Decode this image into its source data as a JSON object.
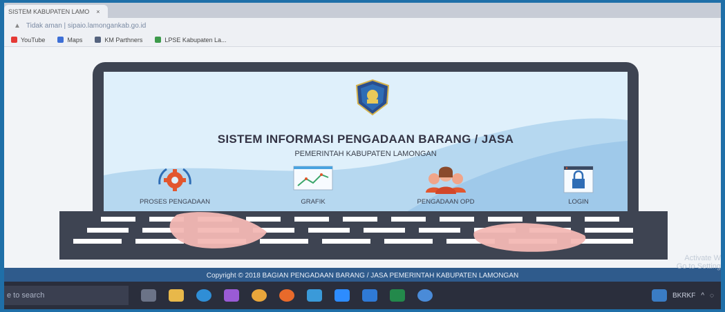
{
  "browser": {
    "tab_title": "SISTEM KABUPATEN LAMO",
    "tab_close": "×",
    "address": "Tidak aman  |  sipaio.lamongankab.go.id",
    "bookmarks": [
      "YouTube",
      "Maps",
      "KM Parthners",
      "LPSE Kabupaten La..."
    ]
  },
  "site": {
    "title": "SISTEM INFORMASI PENGADAAN BARANG / JASA",
    "subtitle": "PEMERINTAH KABUPATEN LAMONGAN",
    "menu": [
      {
        "label": "PROSES PENGADAAN",
        "icon": "gear-icon"
      },
      {
        "label": "GRAFIK",
        "icon": "chart-icon"
      },
      {
        "label": "PENGADAAN OPD",
        "icon": "people-icon"
      },
      {
        "label": "LOGIN",
        "icon": "lock-icon"
      }
    ],
    "copyright": "Copyright © 2018 BAGIAN PENGADAAN BARANG / JASA PEMERINTAH KABUPATEN LAMONGAN"
  },
  "taskbar": {
    "search_placeholder": "e to search",
    "tray_text": "BKRKF"
  },
  "watermark": {
    "line1": "Activate W",
    "line2": "Go to Setting"
  }
}
